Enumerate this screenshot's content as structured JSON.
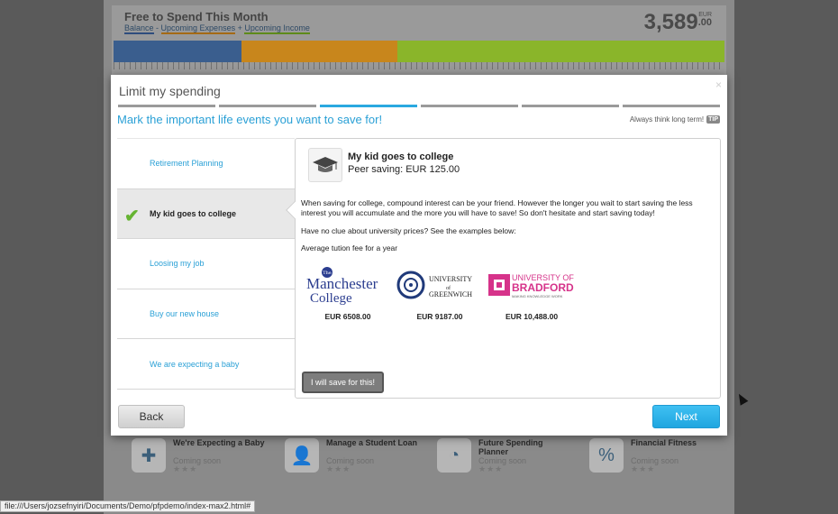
{
  "budget": {
    "title": "Free to Spend This Month",
    "legend_balance": "Balance",
    "legend_sep1": " - ",
    "legend_upcoming_expenses": "Upcoming Expenses",
    "legend_sep2": " + ",
    "legend_upcoming_income": "Upcoming Income",
    "amount_whole": "3,589",
    "amount_decimal": ".00",
    "currency": "EUR",
    "bar_segments": [
      {
        "name": "balance",
        "fraction": 0.21,
        "color": "#3a5e8e"
      },
      {
        "name": "expenses",
        "fraction": 0.255,
        "color": "#c8861c"
      },
      {
        "name": "income",
        "fraction": 0.535,
        "color": "#8ab52a"
      }
    ]
  },
  "modal": {
    "title": "Limit my spending",
    "close_label": "×",
    "steps": [
      false,
      false,
      true,
      false,
      false,
      false
    ],
    "subtitle": "Mark the important life events you want to save for!",
    "tip_text": "Always think long term!",
    "tip_badge": "TIP",
    "events": [
      {
        "label": "Retirement Planning",
        "selected": false
      },
      {
        "label": "My kid goes to college",
        "selected": true
      },
      {
        "label": "Loosing my job",
        "selected": false
      },
      {
        "label": "Buy our new house",
        "selected": false
      },
      {
        "label": "We are expecting a baby",
        "selected": false
      }
    ],
    "detail": {
      "icon": "graduation-cap-icon",
      "title": "My kid goes to college",
      "peer_saving": "Peer saving: EUR 125.00",
      "paragraph1": "When saving for college, compound interest can be your friend. However the longer you wait to start saving the less interest you will accumulate and the more you will have to save! So don't hesitate and start saving today!",
      "paragraph2": "Have no clue about university prices? See the examples below:",
      "paragraph3": "Average tution fee for a year",
      "colleges": [
        {
          "logo_text1": "The",
          "logo_text2": "Manchester",
          "logo_text3": "College",
          "price": "EUR 6508.00"
        },
        {
          "logo_text1": "UNIVERSITY",
          "logo_text2": "of",
          "logo_text3": "GREENWICH",
          "price": "EUR 9187.00"
        },
        {
          "logo_text1": "UNIVERSITY OF",
          "logo_text2": "BRADFORD",
          "logo_text3": "MAKING KNOWLEDGE WORK",
          "price": "EUR 10,488.00"
        }
      ],
      "save_button": "I will save for this!"
    },
    "back_button": "Back",
    "next_button": "Next"
  },
  "tiles": [
    {
      "title": "We're Expecting a Baby",
      "status": "Coming soon",
      "stars": "★★★",
      "icon": "baby-icon"
    },
    {
      "title": "Manage a Student Loan",
      "status": "Coming soon",
      "stars": "★★★",
      "icon": "student-icon"
    },
    {
      "title": "Future Spending Planner",
      "status": "Coming soon",
      "stars": "★★★",
      "icon": "clock-icon"
    },
    {
      "title": "Financial Fitness",
      "status": "Coming soon",
      "stars": "★★★",
      "icon": "percent-icon"
    }
  ],
  "statusbar": {
    "url": "file:///Users/jozsefnyiri/Documents/Demo/pfpdemo/index-max2.html#"
  }
}
